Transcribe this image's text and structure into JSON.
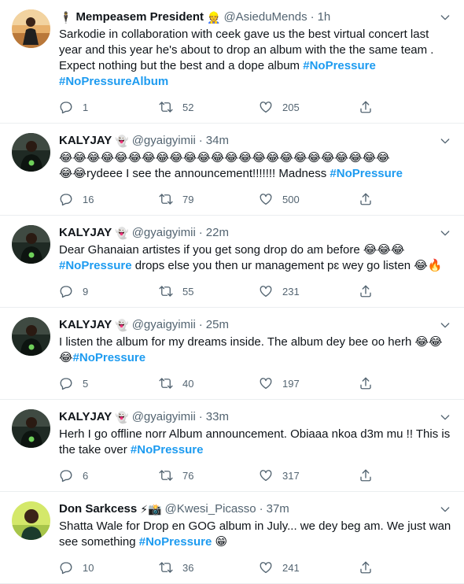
{
  "tweets": [
    {
      "name": "Mempeasem President",
      "badge_prefix": "🕴",
      "badge_suffix": "👷",
      "handle": "@AsieduMends",
      "time": "1h",
      "text": "Sarkodie in collaboration with ceek gave us the best virtual concert last year and this year he's about to drop an album with the the same team . Expect nothing but the best and a dope album ",
      "tags": [
        "#NoPressure",
        " #NoPressureAlbum"
      ],
      "tail": "",
      "replies": "1",
      "retweets": "52",
      "likes": "205",
      "avatar": "person-orange"
    },
    {
      "name": "KALYJAY",
      "badge_prefix": "",
      "badge_suffix": "👻",
      "handle": "@gyaigyimii",
      "time": "34m",
      "text": "😂😂😂😂😂😂😂😂😂😂😂😂😂😂😂😂😂😂😂😂😂😂😂😂\n😂😂rydeee I see the announcement!!!!!!! Madness ",
      "tags": [
        "#NoPressure"
      ],
      "tail": "",
      "replies": "16",
      "retweets": "79",
      "likes": "500",
      "avatar": "person-dark"
    },
    {
      "name": "KALYJAY",
      "badge_prefix": "",
      "badge_suffix": "👻",
      "handle": "@gyaigyimii",
      "time": "22m",
      "text": "Dear Ghanaian artistes if you get song drop do am before 😂😂😂\n",
      "tags": [
        "#NoPressure"
      ],
      "tail": " drops else you then ur management pɛ wey go listen 😂🔥",
      "replies": "9",
      "retweets": "55",
      "likes": "231",
      "avatar": "person-dark"
    },
    {
      "name": "KALYJAY",
      "badge_prefix": "",
      "badge_suffix": "👻",
      "handle": "@gyaigyimii",
      "time": "25m",
      "text": "I listen the album for my dreams inside. The album dey bee oo herh 😂😂\n😂",
      "tags": [
        "#NoPressure"
      ],
      "tail": "",
      "replies": "5",
      "retweets": "40",
      "likes": "197",
      "avatar": "person-dark"
    },
    {
      "name": "KALYJAY",
      "badge_prefix": "",
      "badge_suffix": "👻",
      "handle": "@gyaigyimii",
      "time": "33m",
      "text": "Herh I go offline norr Album announcement. Obiaaa nkoa d3m mu !! This is the take over ",
      "tags": [
        "#NoPressure"
      ],
      "tail": "",
      "replies": "6",
      "retweets": "76",
      "likes": "317",
      "avatar": "person-dark"
    },
    {
      "name": "Don Sarkcess",
      "badge_prefix": "",
      "badge_suffix": "⚡📸",
      "handle": "@Kwesi_Picasso",
      "time": "37m",
      "text": "Shatta Wale for Drop en GOG album in July... we dey beg am. We just wan see something ",
      "tags": [
        "#NoPressure"
      ],
      "tail": " 😁",
      "replies": "10",
      "retweets": "36",
      "likes": "241",
      "avatar": "person-green"
    }
  ],
  "sep": "·",
  "colors": {
    "hashtag": "#1d9bf0",
    "meta": "#536471",
    "divider": "#ebeef0"
  },
  "icons": {
    "reply": "reply-icon",
    "retweet": "retweet-icon",
    "like": "heart-icon",
    "share": "share-icon",
    "more": "chevron-down-icon"
  }
}
